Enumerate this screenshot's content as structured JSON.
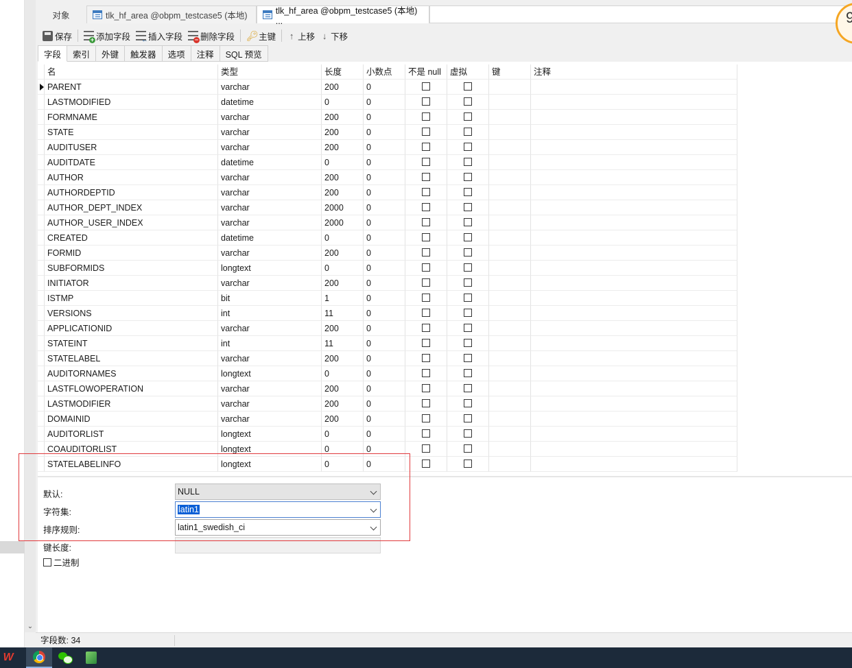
{
  "tabs": [
    {
      "label": "对象"
    },
    {
      "label": "tlk_hf_area @obpm_testcase5 (本地)"
    },
    {
      "label": "tlk_hf_area @obpm_testcase5 (本地) ..."
    }
  ],
  "badge_text": "9",
  "toolbar": {
    "save": "保存",
    "add_field": "添加字段",
    "insert_field": "插入字段",
    "delete_field": "删除字段",
    "primary_key": "主键",
    "move_up": "上移",
    "move_down": "下移"
  },
  "subtabs": [
    "字段",
    "索引",
    "外键",
    "触发器",
    "选项",
    "注释",
    "SQL 预览"
  ],
  "columns": {
    "name": "名",
    "type": "类型",
    "length": "长度",
    "decimals": "小数点",
    "not_null": "不是 null",
    "virtual": "虚拟",
    "key": "键",
    "comment": "注释"
  },
  "fields": [
    {
      "name": "PARENT",
      "type": "varchar",
      "length": "200",
      "decimals": "0"
    },
    {
      "name": "LASTMODIFIED",
      "type": "datetime",
      "length": "0",
      "decimals": "0"
    },
    {
      "name": "FORMNAME",
      "type": "varchar",
      "length": "200",
      "decimals": "0"
    },
    {
      "name": "STATE",
      "type": "varchar",
      "length": "200",
      "decimals": "0"
    },
    {
      "name": "AUDITUSER",
      "type": "varchar",
      "length": "200",
      "decimals": "0"
    },
    {
      "name": "AUDITDATE",
      "type": "datetime",
      "length": "0",
      "decimals": "0"
    },
    {
      "name": "AUTHOR",
      "type": "varchar",
      "length": "200",
      "decimals": "0"
    },
    {
      "name": "AUTHORDEPTID",
      "type": "varchar",
      "length": "200",
      "decimals": "0"
    },
    {
      "name": "AUTHOR_DEPT_INDEX",
      "type": "varchar",
      "length": "2000",
      "decimals": "0"
    },
    {
      "name": "AUTHOR_USER_INDEX",
      "type": "varchar",
      "length": "2000",
      "decimals": "0"
    },
    {
      "name": "CREATED",
      "type": "datetime",
      "length": "0",
      "decimals": "0"
    },
    {
      "name": "FORMID",
      "type": "varchar",
      "length": "200",
      "decimals": "0"
    },
    {
      "name": "SUBFORMIDS",
      "type": "longtext",
      "length": "0",
      "decimals": "0"
    },
    {
      "name": "INITIATOR",
      "type": "varchar",
      "length": "200",
      "decimals": "0"
    },
    {
      "name": "ISTMP",
      "type": "bit",
      "length": "1",
      "decimals": "0"
    },
    {
      "name": "VERSIONS",
      "type": "int",
      "length": "11",
      "decimals": "0"
    },
    {
      "name": "APPLICATIONID",
      "type": "varchar",
      "length": "200",
      "decimals": "0"
    },
    {
      "name": "STATEINT",
      "type": "int",
      "length": "11",
      "decimals": "0"
    },
    {
      "name": "STATELABEL",
      "type": "varchar",
      "length": "200",
      "decimals": "0"
    },
    {
      "name": "AUDITORNAMES",
      "type": "longtext",
      "length": "0",
      "decimals": "0"
    },
    {
      "name": "LASTFLOWOPERATION",
      "type": "varchar",
      "length": "200",
      "decimals": "0"
    },
    {
      "name": "LASTMODIFIER",
      "type": "varchar",
      "length": "200",
      "decimals": "0"
    },
    {
      "name": "DOMAINID",
      "type": "varchar",
      "length": "200",
      "decimals": "0"
    },
    {
      "name": "AUDITORLIST",
      "type": "longtext",
      "length": "0",
      "decimals": "0"
    },
    {
      "name": "COAUDITORLIST",
      "type": "longtext",
      "length": "0",
      "decimals": "0"
    },
    {
      "name": "STATELABELINFO",
      "type": "longtext",
      "length": "0",
      "decimals": "0"
    }
  ],
  "props": {
    "default_label": "默认:",
    "default_value": "NULL",
    "charset_label": "字符集:",
    "charset_value": "latin1",
    "collation_label": "排序规则:",
    "collation_value": "latin1_swedish_ci",
    "keylen_label": "键长度:",
    "binary_label": "二进制"
  },
  "status": {
    "field_count": "字段数: 34"
  },
  "colors": {
    "selection": "#0a5fd6",
    "annotation_box": "#e0383b",
    "taskbar": "#1c2a3a"
  }
}
